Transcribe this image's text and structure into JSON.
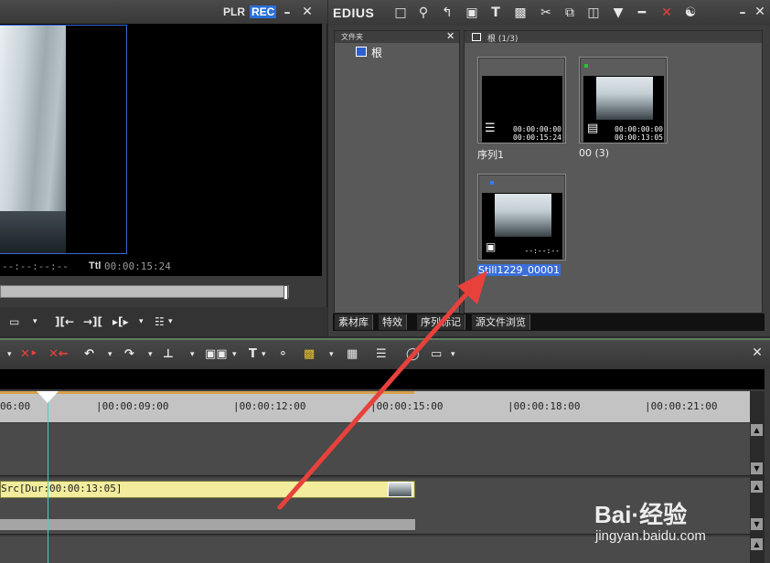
{
  "player": {
    "plr_label": "PLR",
    "rec_label": "REC",
    "timecode_left": "--:--:--:--",
    "ttl_label": "Ttl",
    "ttl_value": "00:00:15:24",
    "controls": [
      "▭",
      "][←",
      "→][",
      "▸[▸",
      "☷"
    ]
  },
  "bin": {
    "app_name": "EDIUS",
    "folder_header": "文件夹",
    "root_folder": "根",
    "clip_header": "根 (1/3)",
    "clips": [
      {
        "name": "序列1",
        "tc_in": "00:00:00:00",
        "tc_out": "00:00:15:24"
      },
      {
        "name": "00 (3)",
        "tc_in": "00:00:00:00",
        "tc_out": "00:00:13:05"
      },
      {
        "name": "Still1229_00001",
        "tc": "--:--:--"
      }
    ],
    "tabs": [
      "素材库",
      "特效",
      "序列标记",
      "源文件浏览"
    ]
  },
  "timeline": {
    "ruler": [
      "06:00",
      "|00:00:09:00",
      "|00:00:12:00",
      "|00:00:15:00",
      "|00:00:18:00",
      "|00:00:21:00"
    ],
    "clip_label": "Src[Dur:00:00:13:05]"
  },
  "watermark": {
    "brand": "Bai·经验",
    "url": "jingyan.baidu.com"
  },
  "colors": {
    "rec_badge": "#2a6fd8",
    "clip_yellow": "#f2ec9c",
    "cursor": "#3fd0d0",
    "arrow": "#e8413c",
    "selection": "#3a6ed8"
  }
}
